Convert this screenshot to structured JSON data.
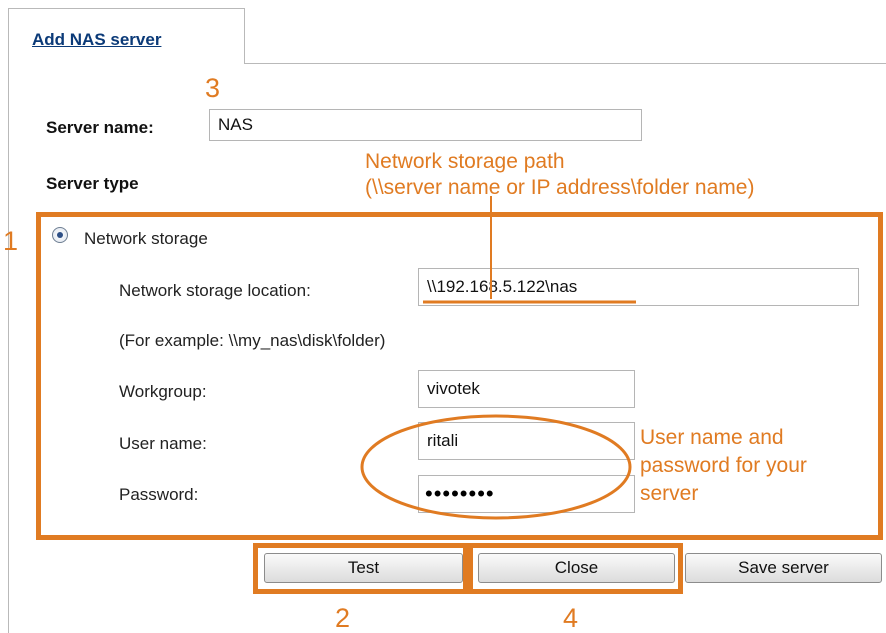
{
  "tab": {
    "label": "Add NAS server"
  },
  "server_name": {
    "label": "Server name:",
    "value": "NAS"
  },
  "server_type": {
    "label": "Server type"
  },
  "network_storage": {
    "radio_label": "Network storage",
    "selected": true,
    "location_label": "Network storage location:",
    "location_value": "\\\\192.168.5.122\\nas",
    "example_text": "(For example: \\\\my_nas\\disk\\folder)",
    "workgroup_label": "Workgroup:",
    "workgroup_value": "vivotek",
    "username_label": "User name:",
    "username_value": "ritali",
    "password_label": "Password:",
    "password_value": "••••••••"
  },
  "buttons": {
    "test": "Test",
    "close": "Close",
    "save": "Save server"
  },
  "annotations": {
    "n1": "1",
    "n2": "2",
    "n3": "3",
    "n4": "4",
    "path_line1": "Network storage path",
    "path_line2": "(\\\\server name or IP address\\folder name)",
    "cred_line1": "User name and",
    "cred_line2": "password for your",
    "cred_line3": "server"
  },
  "colors": {
    "annotation": "#e07b22",
    "tab_link": "#0b3a78"
  },
  "icons": {
    "radio": "radio-button-icon"
  }
}
